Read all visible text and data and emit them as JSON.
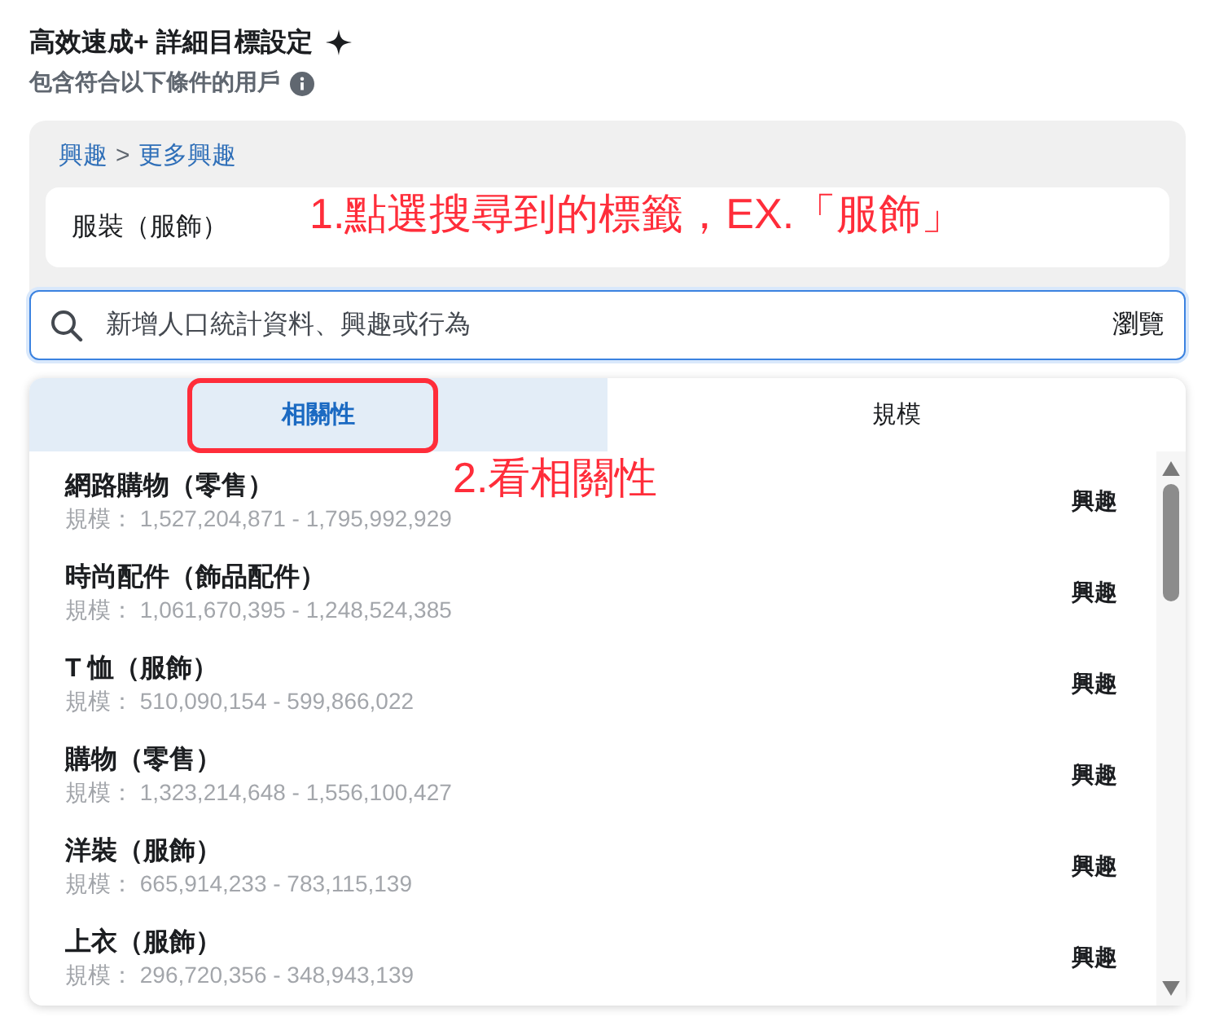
{
  "title": "高效速成+ 詳細目標設定",
  "subtitle": "包含符合以下條件的用戶",
  "breadcrumb": {
    "parent": "興趣",
    "separator": ">",
    "current": "更多興趣"
  },
  "selected_tags": [
    "服裝（服飾）"
  ],
  "search": {
    "placeholder": "新增人口統計資料、興趣或行為",
    "browse": "瀏覽"
  },
  "tabs": [
    {
      "label": "相關性",
      "selected": true
    },
    {
      "label": "規模",
      "selected": false
    }
  ],
  "results": [
    {
      "name": "網路購物（零售）",
      "size": "規模： 1,527,204,871 - 1,795,992,929",
      "type": "興趣"
    },
    {
      "name": "時尚配件（飾品配件）",
      "size": "規模： 1,061,670,395 - 1,248,524,385",
      "type": "興趣"
    },
    {
      "name": "T 恤（服飾）",
      "size": "規模： 510,090,154 - 599,866,022",
      "type": "興趣"
    },
    {
      "name": "購物（零售）",
      "size": "規模： 1,323,214,648 - 1,556,100,427",
      "type": "興趣"
    },
    {
      "name": "洋裝（服飾）",
      "size": "規模： 665,914,233 - 783,115,139",
      "type": "興趣"
    },
    {
      "name": "上衣（服飾）",
      "size": "規模： 296,720,356 - 348,943,139",
      "type": "興趣"
    }
  ],
  "annotations": [
    {
      "kind": "tag",
      "text": "1.點選搜尋到的標籤，EX.「服飾」"
    },
    {
      "kind": "tab",
      "text": "2.看相關性"
    }
  ]
}
